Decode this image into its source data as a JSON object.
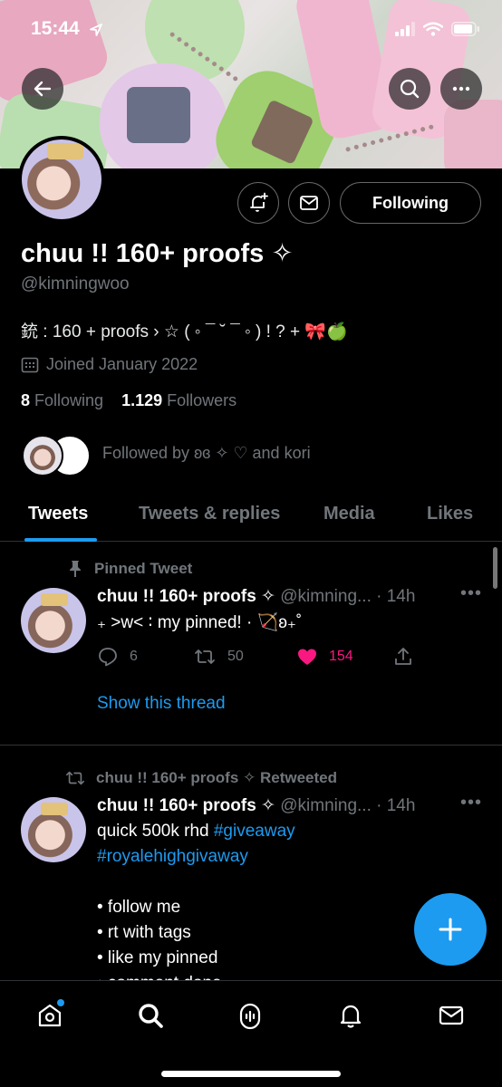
{
  "status_bar": {
    "time": "15:44"
  },
  "header": {
    "back_icon": "arrow-left-icon",
    "search_icon": "search-icon",
    "more_icon": "more-icon"
  },
  "profile": {
    "name": "chuu !! 160+ proofs ✧",
    "handle": "@kimningwoo",
    "bio": "銃 : 160 + proofs ›  ☆ ( ◦ ¯ ˘ ¯ ◦ ) ! ? + 🎀🍏",
    "joined": "Joined January 2022",
    "following_count": "8",
    "following_label": "Following",
    "followers_count": "1.129",
    "followers_label": "Followers",
    "followed_by": "Followed by ʚɞ ✧ ♡ and kori",
    "following_button": "Following"
  },
  "tabs": [
    {
      "label": "Tweets",
      "active": true
    },
    {
      "label": "Tweets & replies",
      "active": false
    },
    {
      "label": "Media",
      "active": false
    },
    {
      "label": "Likes",
      "active": false
    }
  ],
  "pinned_tweet": {
    "context": "Pinned Tweet",
    "author": "chuu !! 160+ proofs ✧",
    "handle_time": "@kimning... · 14h",
    "text": "₊ >w< ∶ my  pinned! · 🏹ʚ₊˚",
    "replies": "6",
    "retweets": "50",
    "likes": "154",
    "show_thread": "Show this thread"
  },
  "retweet": {
    "context": "chuu !! 160+ proofs ✧ Retweeted",
    "author": "chuu !! 160+ proofs ✧",
    "handle_time": "@kimning... · 14h",
    "line1": "quick 500k rhd ",
    "hashtag1": "#giveaway",
    "hashtag2": "#royalehighgivaway",
    "bullets": [
      "• follow me",
      "• rt with tags",
      "• like my pinned",
      "• comment done"
    ]
  },
  "colors": {
    "accent": "#1d9bf0",
    "like": "#f91880",
    "muted": "#71767b",
    "background": "#000000"
  },
  "nav": [
    "home-icon",
    "search-icon",
    "spaces-icon",
    "notifications-icon",
    "messages-icon"
  ]
}
